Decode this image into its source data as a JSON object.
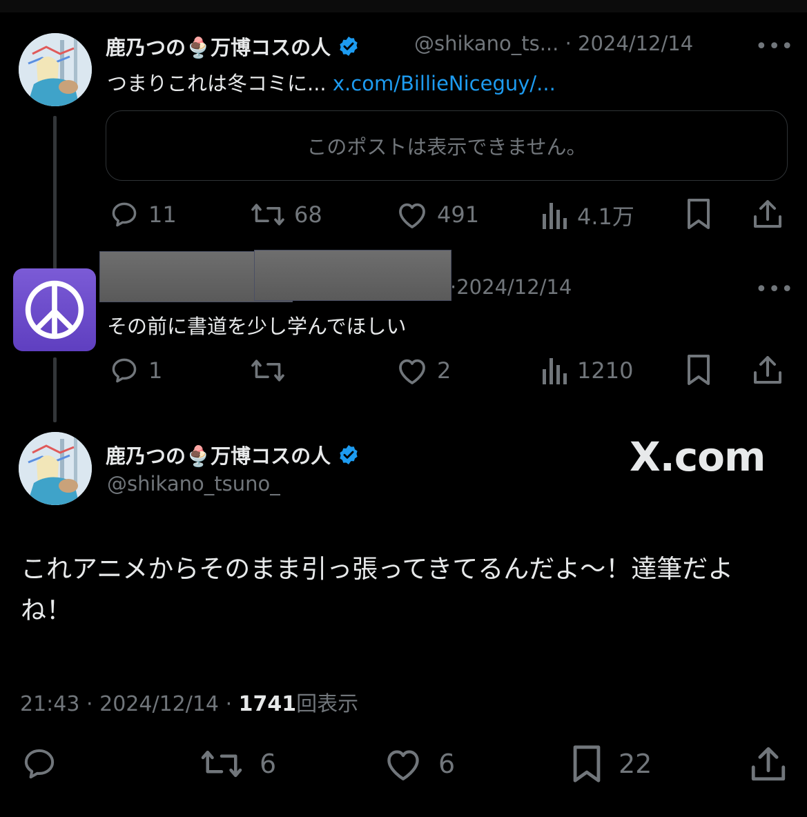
{
  "tweet1": {
    "display_name": "鹿乃つの🍨万博コスの人",
    "handle": "@shikano_ts...",
    "separator": "·",
    "date": "2024/12/14",
    "more": "•••",
    "text": "つまりこれは冬コミに...",
    "link": "x.com/BillieNiceguy/...",
    "quote_unavailable": "このポストは表示できません。",
    "replies": "11",
    "retweets": "68",
    "likes": "491",
    "views": "4.1万"
  },
  "tweet2": {
    "separator": "·",
    "date": "2024/12/14",
    "more": "•••",
    "text": "その前に書道を少し学んでほしい",
    "replies": "1",
    "retweets": "",
    "likes": "2",
    "views": "1210"
  },
  "main_tweet": {
    "display_name": "鹿乃つの🍨万博コスの人",
    "handle": "@shikano_tsuno_",
    "watermark": "X.com",
    "text_line1": "これアニメからそのまま引っ張ってきてるんだよ～！達筆だよ",
    "text_line2": "ね！",
    "time": "21:43",
    "sep1": "·",
    "date": "2024/12/14",
    "sep2": "·",
    "views_count": "1741",
    "views_label": "回表示",
    "retweets": "6",
    "likes": "6",
    "bookmarks": "22"
  },
  "colors": {
    "background": "#000000",
    "text_primary": "#e7e9ea",
    "text_secondary": "#71767b",
    "link": "#1d9bf0",
    "verified": "#1d9bf0",
    "peace_tile": "#6a4bcc"
  },
  "icons": [
    "reply-icon",
    "retweet-icon",
    "like-icon",
    "views-icon",
    "bookmark-icon",
    "share-icon",
    "verified-badge-icon",
    "peace-symbol-icon"
  ]
}
